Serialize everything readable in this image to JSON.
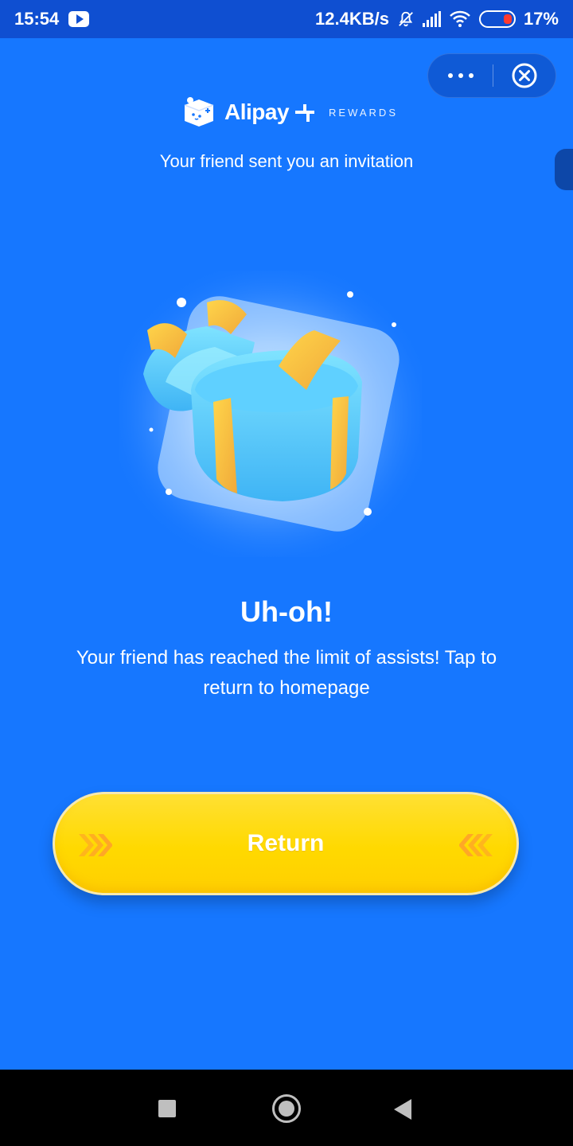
{
  "status_bar": {
    "time": "15:54",
    "network_speed": "12.4KB/s",
    "battery": "17%",
    "icons": [
      "youtube-icon",
      "bell-off-icon",
      "signal-icon",
      "wifi-icon",
      "battery-icon"
    ]
  },
  "capsule": {
    "more_icon": "more-icon",
    "close_icon": "close-circle-icon"
  },
  "brand": {
    "name": "Alipay",
    "sub": "REWARDS"
  },
  "header": {
    "subtitle": "Your friend sent you an invitation"
  },
  "content": {
    "headline": "Uh-oh!",
    "message": "Your friend has reached the limit of assists! Tap to return to homepage"
  },
  "return_button": {
    "label": "Return"
  },
  "colors": {
    "background": "#1677ff",
    "status_bar": "#0f4fd1",
    "button": "#ffd900",
    "chevron": "#ffa726"
  },
  "nav_bar": {
    "icons": [
      "recent-apps-icon",
      "home-icon",
      "back-icon"
    ]
  }
}
